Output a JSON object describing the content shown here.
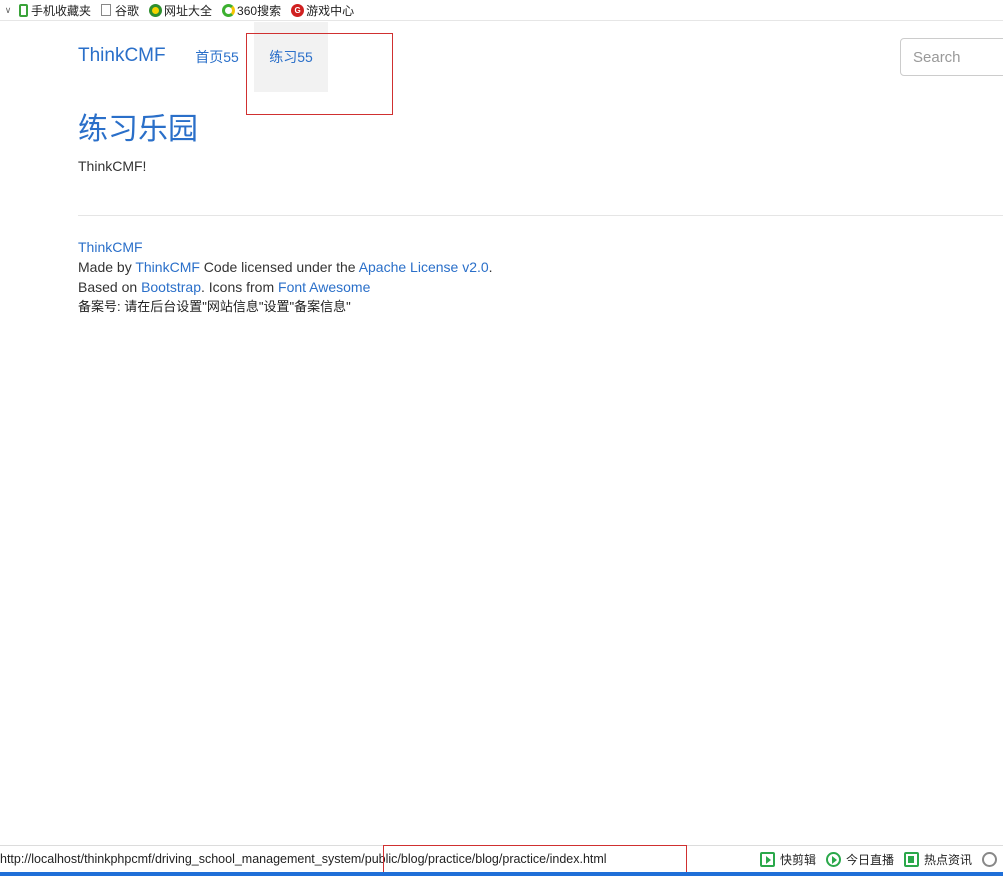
{
  "bookmarks": [
    {
      "icon": "phone-icon",
      "label": "手机收藏夹"
    },
    {
      "icon": "page-icon",
      "label": "谷歌"
    },
    {
      "icon": "globe-icon",
      "label": "网址大全"
    },
    {
      "icon": "360-icon",
      "label": "360搜索"
    },
    {
      "icon": "game-icon",
      "label": "游戏中心"
    }
  ],
  "navbar": {
    "brand": "ThinkCMF",
    "items": [
      {
        "label": "首页55"
      },
      {
        "label": "练习55",
        "active": true
      }
    ],
    "search_placeholder": "Search"
  },
  "main": {
    "title": "练习乐园",
    "text": "ThinkCMF!"
  },
  "footer": {
    "brand_link": "ThinkCMF",
    "made_by": "Made by ",
    "made_by_link": "ThinkCMF",
    "code_licensed": " Code licensed under the ",
    "license_link": "Apache License v2.0",
    "period1": ".",
    "based_on": "Based on ",
    "bootstrap_link": "Bootstrap",
    "icons_from": ". Icons from ",
    "fontawesome_link": "Font Awesome",
    "icp": "备案号: 请在后台设置\"网站信息\"设置\"备案信息\""
  },
  "statusbar": {
    "url": "http://localhost/thinkphpcmf/driving_school_management_system/public/blog/practice/blog/practice/index.html",
    "tools": [
      {
        "icon": "scissors-icon",
        "label": "快剪辑"
      },
      {
        "icon": "play-icon",
        "label": "今日直播"
      },
      {
        "icon": "news-icon",
        "label": "热点资讯"
      }
    ]
  },
  "colors": {
    "link": "#2a6fc9",
    "annotation": "#d03030",
    "accent_green": "#2aa84a"
  }
}
